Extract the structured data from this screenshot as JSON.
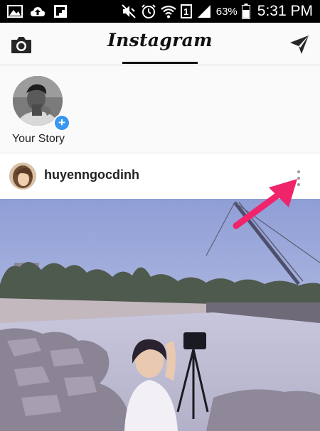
{
  "status_bar": {
    "battery_percent": "63%",
    "time": "5:31 PM",
    "sim_slot": "1",
    "icons": [
      "gallery-icon",
      "cloud-upload-icon",
      "flipboard-icon",
      "mute-icon",
      "alarm-icon",
      "wifi-icon",
      "sim-icon",
      "signal-icon",
      "battery-icon"
    ]
  },
  "header": {
    "title": "Instagram",
    "camera_icon": "camera-icon",
    "direct_icon": "paper-plane-icon"
  },
  "stories": {
    "items": [
      {
        "label": "Your Story",
        "badge_icon": "add-plus-icon"
      }
    ]
  },
  "post": {
    "username": "huyenngocdinh",
    "more_icon": "more-vertical-icon"
  },
  "annotation": {
    "color": "#f0246b",
    "points_to": "post-more-options-button"
  },
  "colors": {
    "accent_blue": "#3897f0",
    "text": "#222222",
    "status_bar_bg": "#000000"
  }
}
